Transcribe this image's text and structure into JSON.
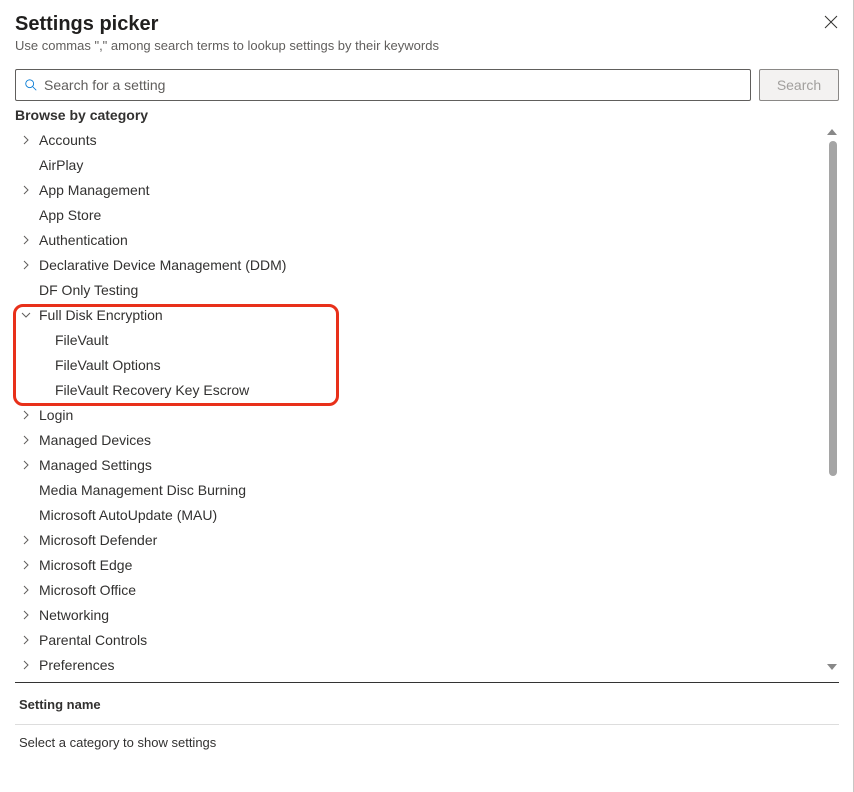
{
  "header": {
    "title": "Settings picker",
    "subtitle": "Use commas \",\" among search terms to lookup settings by their keywords"
  },
  "search": {
    "placeholder": "Search for a setting",
    "button_label": "Search"
  },
  "browse_label": "Browse by category",
  "categories": [
    {
      "label": "Accounts",
      "expandable": true,
      "expanded": false,
      "children": []
    },
    {
      "label": "AirPlay",
      "expandable": false,
      "expanded": false,
      "children": []
    },
    {
      "label": "App Management",
      "expandable": true,
      "expanded": false,
      "children": []
    },
    {
      "label": "App Store",
      "expandable": false,
      "expanded": false,
      "children": []
    },
    {
      "label": "Authentication",
      "expandable": true,
      "expanded": false,
      "children": []
    },
    {
      "label": "Declarative Device Management (DDM)",
      "expandable": true,
      "expanded": false,
      "children": []
    },
    {
      "label": "DF Only Testing",
      "expandable": false,
      "expanded": false,
      "children": []
    },
    {
      "label": "Full Disk Encryption",
      "expandable": true,
      "expanded": true,
      "children": [
        {
          "label": "FileVault"
        },
        {
          "label": "FileVault Options"
        },
        {
          "label": "FileVault Recovery Key Escrow"
        }
      ]
    },
    {
      "label": "Login",
      "expandable": true,
      "expanded": false,
      "children": []
    },
    {
      "label": "Managed Devices",
      "expandable": true,
      "expanded": false,
      "children": []
    },
    {
      "label": "Managed Settings",
      "expandable": true,
      "expanded": false,
      "children": []
    },
    {
      "label": "Media Management Disc Burning",
      "expandable": false,
      "expanded": false,
      "children": []
    },
    {
      "label": "Microsoft AutoUpdate (MAU)",
      "expandable": false,
      "expanded": false,
      "children": []
    },
    {
      "label": "Microsoft Defender",
      "expandable": true,
      "expanded": false,
      "children": []
    },
    {
      "label": "Microsoft Edge",
      "expandable": true,
      "expanded": false,
      "children": []
    },
    {
      "label": "Microsoft Office",
      "expandable": true,
      "expanded": false,
      "children": []
    },
    {
      "label": "Networking",
      "expandable": true,
      "expanded": false,
      "children": []
    },
    {
      "label": "Parental Controls",
      "expandable": true,
      "expanded": false,
      "children": []
    },
    {
      "label": "Preferences",
      "expandable": true,
      "expanded": false,
      "children": []
    }
  ],
  "setting_section": {
    "header": "Setting name",
    "empty_text": "Select a category to show settings"
  }
}
